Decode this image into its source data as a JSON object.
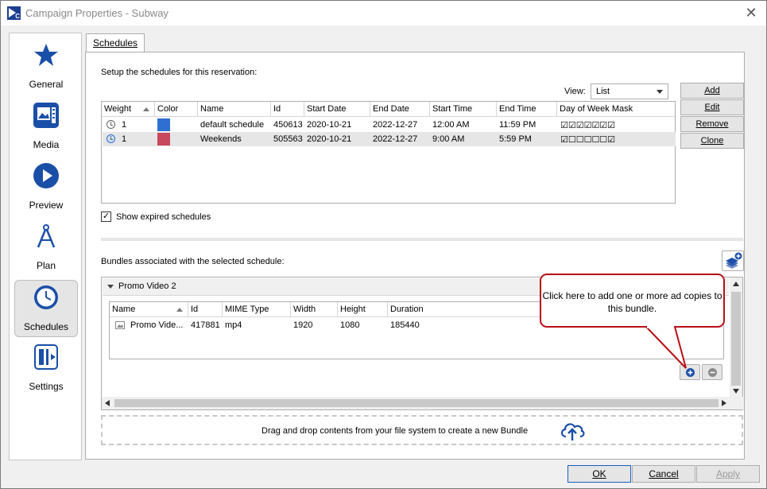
{
  "window": {
    "title": "Campaign Properties - Subway",
    "app_icon_letter": "C"
  },
  "sidebar": {
    "items": [
      {
        "label": "General",
        "icon": "star-icon"
      },
      {
        "label": "Media",
        "icon": "media-icon"
      },
      {
        "label": "Preview",
        "icon": "play-icon"
      },
      {
        "label": "Plan",
        "icon": "compass-icon"
      },
      {
        "label": "Schedules",
        "icon": "clock-icon",
        "active": true
      },
      {
        "label": "Settings",
        "icon": "settings-icon"
      }
    ]
  },
  "tab": {
    "label": "Schedules"
  },
  "schedules": {
    "intro": "Setup the schedules for this reservation:",
    "view_label": "View:",
    "view_value": "List",
    "buttons": {
      "add": "Add",
      "edit": "Edit",
      "remove": "Remove",
      "clone": "Clone"
    },
    "columns": [
      "Weight",
      "Color",
      "Name",
      "Id",
      "Start Date",
      "End Date",
      "Start Time",
      "End Time",
      "Day of Week Mask"
    ],
    "rows": [
      {
        "weight": "1",
        "color": "#2f6fd1",
        "name": "default schedule",
        "id": "450613",
        "start_date": "2020-10-21",
        "end_date": "2022-12-27",
        "start_time": "12:00 AM",
        "end_time": "11:59 PM",
        "mask": "☑☑☑☑☑☑☑"
      },
      {
        "weight": "1",
        "color": "#c8485d",
        "name": "Weekends",
        "id": "505563",
        "start_date": "2020-10-21",
        "end_date": "2022-12-27",
        "start_time": "9:00 AM",
        "end_time": "5:59 PM",
        "mask": "☑☐☐☐☐☐☑"
      }
    ],
    "show_expired_label": "Show expired schedules",
    "show_expired_checked": true
  },
  "bundles": {
    "label": "Bundles associated with the selected schedule:",
    "panel_title": "Promo Video 2",
    "columns": [
      "Name",
      "Id",
      "MIME Type",
      "Width",
      "Height",
      "Duration"
    ],
    "rows": [
      {
        "name": "Promo Vide...",
        "id": "417881",
        "mime": "mp4",
        "width": "1920",
        "height": "1080",
        "duration": "185440"
      }
    ],
    "dropzone_text": "Drag and drop contents from your file system to create a new Bundle"
  },
  "callout": {
    "text": "Click here to add one or more ad copies to this bundle."
  },
  "footer": {
    "ok": "OK",
    "cancel": "Cancel",
    "apply": "Apply"
  },
  "colors": {
    "accent": "#1a5dc0",
    "callout_border": "#b80f16"
  }
}
